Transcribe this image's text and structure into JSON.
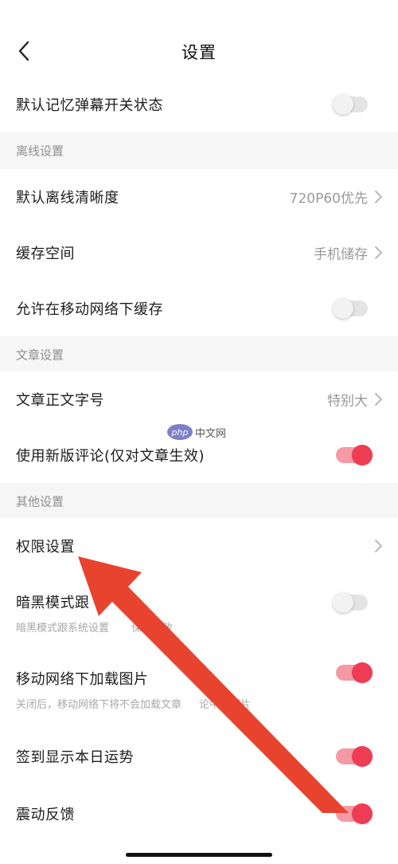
{
  "header": {
    "title": "设置"
  },
  "rows": {
    "danmu_memory": {
      "label": "默认记忆弹幕开关状态",
      "toggle": "off"
    },
    "offline_quality": {
      "label": "默认离线清晰度",
      "value": "720P60优先"
    },
    "cache_space": {
      "label": "缓存空间",
      "value": "手机储存"
    },
    "mobile_cache": {
      "label": "允许在移动网络下缓存",
      "toggle": "off"
    },
    "font_size": {
      "label": "文章正文字号",
      "value": "特别大"
    },
    "new_comments": {
      "label": "使用新版评论(仅对文章生效)",
      "toggle": "on"
    },
    "permissions": {
      "label": "权限设置"
    },
    "dark_mode": {
      "label": "暗黑模式跟",
      "sub": "暗黑模式跟系统设置",
      "sub_tail": "保持一致",
      "toggle": "off"
    },
    "mobile_images": {
      "label": "移动网络下加载图片",
      "sub": "关闭后，移动网络下将不会加载文章",
      "sub_tail": "论中的图片",
      "toggle": "on"
    },
    "checkin_fortune": {
      "label": "签到显示本日运势",
      "toggle": "on"
    },
    "vibration": {
      "label": "震动反馈",
      "toggle": "on"
    }
  },
  "sections": {
    "offline": "离线设置",
    "article": "文章设置",
    "other": "其他设置"
  },
  "watermark": {
    "logo": "php",
    "text": "中文网"
  },
  "colors": {
    "accent": "#ee3c55",
    "annotation_arrow": "#e8432e",
    "section_bg": "#f6f6f6"
  }
}
